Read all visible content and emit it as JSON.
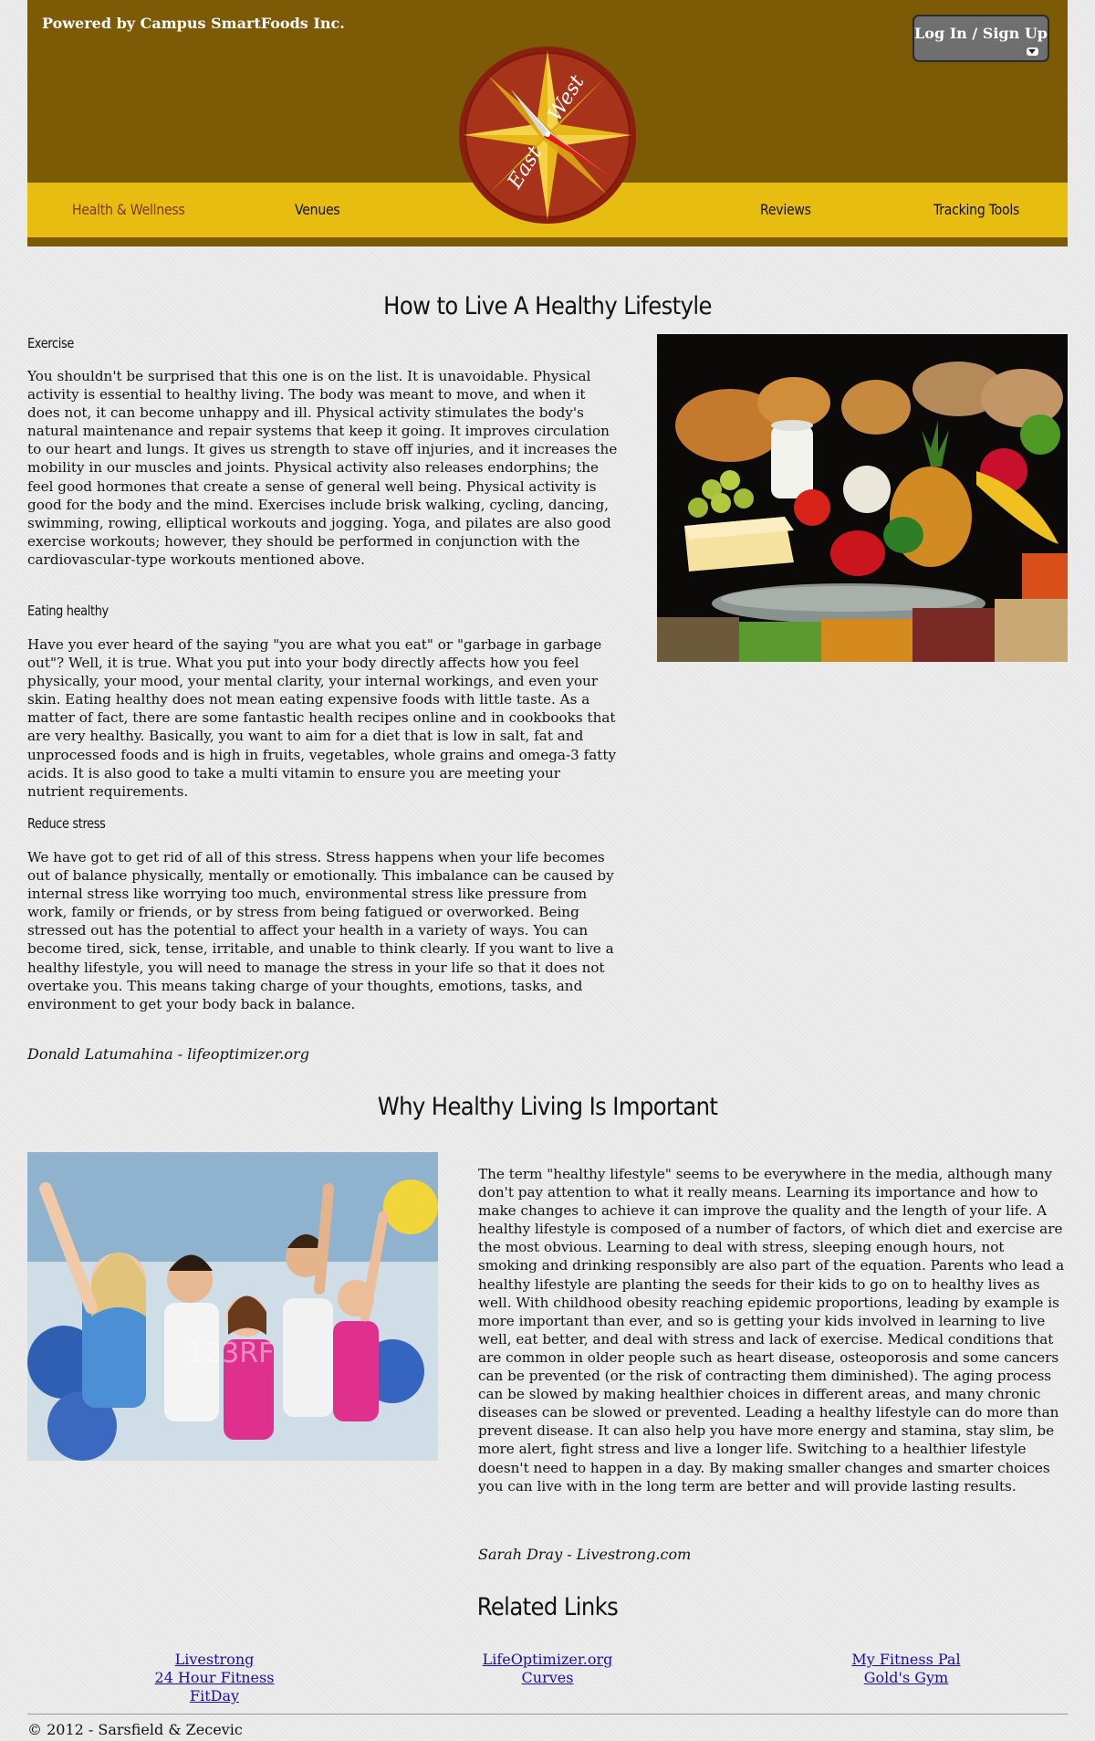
{
  "header": {
    "powered_by": "Powered by Campus SmartFoods Inc.",
    "login_label": "Log In / Sign Up",
    "logo_text_east": "East",
    "logo_text_west": "West",
    "colors": {
      "header_brown": "#7c5a06",
      "nav_yellow": "#e6bd10",
      "active_nav": "#7a3a0a"
    }
  },
  "nav": [
    {
      "label": "Health & Wellness",
      "active": true
    },
    {
      "label": "Venues"
    },
    {
      "label": "Reviews"
    },
    {
      "label": "Tracking Tools"
    }
  ],
  "section1": {
    "title": "How to Live A Healthy Lifestyle",
    "exercise_heading": "Exercise",
    "exercise_text": "You shouldn't be surprised that this one is on the list. It is unavoidable. Physical activity is essential to healthy living. The body was meant to move, and when it does not, it can become unhappy and ill. Physical activity stimulates the body's natural maintenance and repair systems that keep it going. It improves circulation to our heart and lungs. It gives us strength to stave off injuries, and it increases the mobility in our muscles and joints. Physical activity also releases endorphins; the feel good hormones that create a sense of general well being. Physical activity is good for the body and the mind. Exercises include brisk walking, cycling, dancing, swimming, rowing, elliptical workouts and jogging. Yoga, and pilates are also good exercise workouts; however, they should be performed in conjunction with the cardiovascular-type workouts mentioned above.",
    "eating_heading": "Eating healthy",
    "eating_text": "Have you ever heard of the saying \"you are what you eat\" or \"garbage in garbage out\"? Well, it is true. What you put into your body directly affects how you feel physically, your mood, your mental clarity, your internal workings, and even your skin. Eating healthy does not mean eating expensive foods with little taste. As a matter of fact, there are some fantastic health recipes online and in cookbooks that are very healthy. Basically, you want to aim for a diet that is low in salt, fat and unprocessed foods and is high in fruits, vegetables, whole grains and omega-3 fatty acids. It is also good to take a multi vitamin to ensure you are meeting your nutrient requirements.",
    "stress_heading": "Reduce stress",
    "stress_text": "We have got to get rid of all of this stress. Stress happens when your life becomes out of balance physically, mentally or emotionally. This imbalance can be caused by internal stress like worrying too much, environmental stress like pressure from work, family or friends, or by stress from being fatigued or overworked. Being stressed out has the potential to affect your health in a variety of ways. You can become tired, sick, tense, irritable, and unable to think clearly. If you want to live a healthy lifestyle, you will need to manage the stress in your life so that it does not overtake you. This means taking charge of your thoughts, emotions, tasks, and environment to get your body back in balance.",
    "credit": "Donald Latumahina - lifeoptimizer.org"
  },
  "section2": {
    "title": "Why Healthy Living Is Important",
    "text": "The term \"healthy lifestyle\" seems to be everywhere in the media, although many don't pay attention to what it really means. Learning its importance and how to make changes to achieve it can improve the quality and the length of your life. A healthy lifestyle is composed of a number of factors, of which diet and exercise are the most obvious. Learning to deal with stress, sleeping enough hours, not smoking and drinking responsibly are also part of the equation. Parents who lead a healthy lifestyle are planting the seeds for their kids to go on to healthy lives as well. With childhood obesity reaching epidemic proportions, leading by example is more important than ever, and so is getting your kids involved in learning to live well, eat better, and deal with stress and lack of exercise. Medical conditions that are common in older people such as heart disease, osteoporosis and some cancers can be prevented (or the risk of contracting them diminished). The aging process can be slowed by making healthier choices in different areas, and many chronic diseases can be slowed or prevented. Leading a healthy lifestyle can do more than prevent disease. It can also help you have more energy and stamina, stay slim, be more alert, fight stress and live a longer life. Switching to a healthier lifestyle doesn't need to happen in a day. By making smaller changes and smarter choices you can live with in the long term are better and will provide lasting results.",
    "credit": "Sarah Dray - Livestrong.com",
    "watermark": "123RF"
  },
  "related": {
    "title": "Related Links",
    "col1": [
      "Livestrong",
      "24 Hour Fitness",
      "FitDay"
    ],
    "col2": [
      "LifeOptimizer.org",
      "Curves"
    ],
    "col3": [
      "My Fitness Pal",
      "Gold's Gym"
    ]
  },
  "footer": {
    "copyright": "© 2012 - Sarsfield & Zecevic"
  }
}
